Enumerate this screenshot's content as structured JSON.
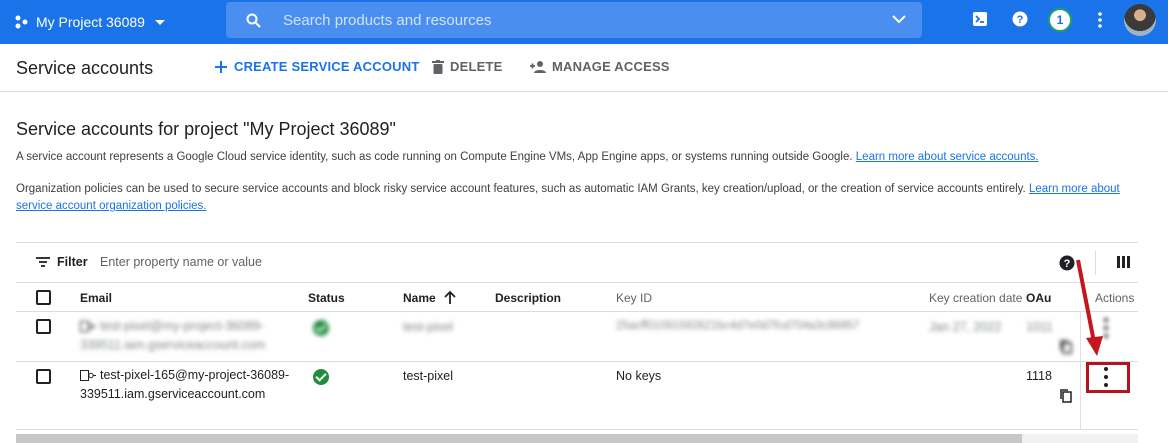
{
  "topbar": {
    "project_name": "My Project 36089",
    "search_placeholder": "Search products and resources",
    "notification_count": "1"
  },
  "toolbar": {
    "title": "Service accounts",
    "create_label": "CREATE SERVICE ACCOUNT",
    "delete_label": "DELETE",
    "manage_label": "MANAGE ACCESS"
  },
  "content": {
    "heading": "Service accounts for project \"My Project 36089\"",
    "para1_text": "A service account represents a Google Cloud service identity, such as code running on Compute Engine VMs, App Engine apps, or systems running outside Google.",
    "para1_link": "Learn more about service accounts.",
    "para2_text": "Organization policies can be used to secure service accounts and block risky service account features, such as automatic IAM Grants, key creation/upload, or the creation of service accounts entirely.",
    "para2_link": "Learn more about service account organization policies."
  },
  "filter": {
    "label": "Filter",
    "placeholder": "Enter property name or value"
  },
  "table": {
    "headers": {
      "email": "Email",
      "status": "Status",
      "name": "Name",
      "description": "Description",
      "key_id": "Key ID",
      "key_creation": "Key creation date",
      "oauth": "OAu",
      "actions": "Actions"
    },
    "rows": [
      {
        "email": "test-pixel@my-project-36089-339511.iam.gserviceaccount.com",
        "name": "test-pixel",
        "key_id": "25acff01091592621bc4d7e0d7fcd704a3c86957",
        "key_date": "Jan 27, 2022",
        "oauth": "1011"
      },
      {
        "email": "test-pixel-165@my-project-36089-339511.iam.gserviceaccount.com",
        "name": "test-pixel",
        "key_id": "No keys",
        "key_date": "",
        "oauth": "1118"
      }
    ]
  },
  "colors": {
    "brand_blue": "#1a73e8",
    "status_green": "#1e8e3e",
    "highlight_red": "#b3141e"
  }
}
